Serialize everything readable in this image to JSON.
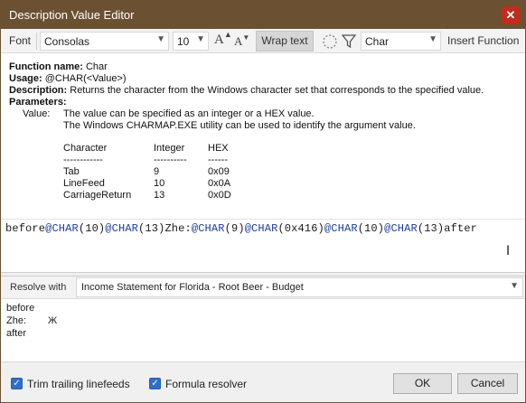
{
  "window": {
    "title": "Description Value Editor"
  },
  "toolbar": {
    "font_label": "Font",
    "font_value": "Consolas",
    "size_value": "10",
    "grow_font": "A",
    "shrink_font": "A",
    "wrap_text": "Wrap text",
    "function_value": "Char",
    "insert_function": "Insert Function"
  },
  "info": {
    "function_name_label": "Function name:",
    "function_name": "Char",
    "usage_label": "Usage:",
    "usage": "@CHAR(<Value>)",
    "description_label": "Description:",
    "description": "Returns the character from the Windows character set that corresponds to the specified value.",
    "parameters_label": "Parameters:",
    "value_label": "Value:",
    "value_line1": "The value can be specified as an integer or a HEX value.",
    "value_line2": "The Windows CHARMAP.EXE utility can be used to identify the argument value.",
    "table": {
      "headers": [
        "Character",
        "Integer",
        "HEX"
      ],
      "dashes": [
        "------------",
        "----------",
        "------"
      ],
      "rows": [
        [
          "Tab",
          "9",
          "0x09"
        ],
        [
          "LineFeed",
          "10",
          "0x0A"
        ],
        [
          "CarriageReturn",
          "13",
          "0x0D"
        ]
      ]
    }
  },
  "editor": {
    "tokens": [
      {
        "text": "before",
        "kind": "plain"
      },
      {
        "text": "@CHAR",
        "kind": "func"
      },
      {
        "text": "(10)",
        "kind": "plain"
      },
      {
        "text": "@CHAR",
        "kind": "func"
      },
      {
        "text": "(13)Zhe:",
        "kind": "plain"
      },
      {
        "text": "@CHAR",
        "kind": "func"
      },
      {
        "text": "(9)",
        "kind": "plain"
      },
      {
        "text": "@CHAR",
        "kind": "func"
      },
      {
        "text": "(0x416)",
        "kind": "plain"
      },
      {
        "text": "@CHAR",
        "kind": "func"
      },
      {
        "text": "(10)",
        "kind": "plain"
      },
      {
        "text": "@CHAR",
        "kind": "func"
      },
      {
        "text": "(13)after",
        "kind": "plain"
      }
    ]
  },
  "resolve": {
    "label": "Resolve with",
    "value": "Income Statement for Florida - Root Beer - Budget"
  },
  "output": {
    "line1": "before",
    "line2_label": "Zhe:",
    "line2_value": "Ж",
    "line3": "after"
  },
  "footer": {
    "trim_label": "Trim trailing linefeeds",
    "trim_checked": true,
    "resolver_label": "Formula resolver",
    "resolver_checked": true,
    "ok_label": "OK",
    "cancel_label": "Cancel"
  },
  "colors": {
    "titlebar": "#6b5132",
    "close": "#c42b1c",
    "function_token": "#1f3ea0",
    "checkbox": "#2f6fc7"
  }
}
